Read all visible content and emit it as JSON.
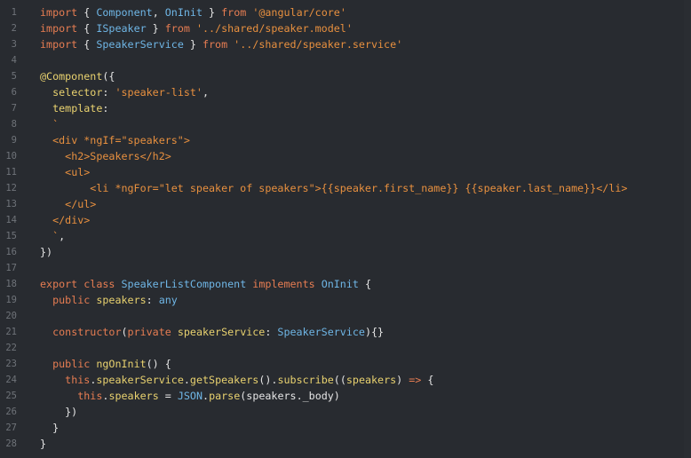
{
  "editor": {
    "lines": [
      {
        "n": "1",
        "tokens": [
          [
            "kw",
            "import "
          ],
          [
            "plain",
            "{ "
          ],
          [
            "ty",
            "Component"
          ],
          [
            "plain",
            ", "
          ],
          [
            "ty",
            "OnInit"
          ],
          [
            "plain",
            " } "
          ],
          [
            "kw",
            "from "
          ],
          [
            "str",
            "'@angular/core'"
          ]
        ]
      },
      {
        "n": "2",
        "tokens": [
          [
            "kw",
            "import "
          ],
          [
            "plain",
            "{ "
          ],
          [
            "ty",
            "ISpeaker"
          ],
          [
            "plain",
            " } "
          ],
          [
            "kw",
            "from "
          ],
          [
            "str",
            "'../shared/speaker.model'"
          ]
        ]
      },
      {
        "n": "3",
        "tokens": [
          [
            "kw",
            "import "
          ],
          [
            "plain",
            "{ "
          ],
          [
            "ty",
            "SpeakerService"
          ],
          [
            "plain",
            " } "
          ],
          [
            "kw",
            "from "
          ],
          [
            "str",
            "'../shared/speaker.service'"
          ]
        ]
      },
      {
        "n": "4",
        "tokens": []
      },
      {
        "n": "5",
        "tokens": [
          [
            "fn",
            "@Component"
          ],
          [
            "plain",
            "({"
          ]
        ]
      },
      {
        "n": "6",
        "tokens": [
          [
            "plain",
            "  "
          ],
          [
            "fn",
            "selector"
          ],
          [
            "plain",
            ": "
          ],
          [
            "str",
            "'speaker-list'"
          ],
          [
            "plain",
            ","
          ]
        ]
      },
      {
        "n": "7",
        "tokens": [
          [
            "plain",
            "  "
          ],
          [
            "fn",
            "template"
          ],
          [
            "plain",
            ":"
          ]
        ]
      },
      {
        "n": "8",
        "tokens": [
          [
            "plain",
            "  "
          ],
          [
            "tpl",
            "`"
          ]
        ]
      },
      {
        "n": "9",
        "tokens": [
          [
            "plain",
            "  "
          ],
          [
            "tpl",
            "<div *ngIf=\"speakers\">"
          ]
        ]
      },
      {
        "n": "10",
        "tokens": [
          [
            "plain",
            "    "
          ],
          [
            "tpl",
            "<h2>Speakers</h2>"
          ]
        ]
      },
      {
        "n": "11",
        "tokens": [
          [
            "plain",
            "    "
          ],
          [
            "tpl",
            "<ul>"
          ]
        ]
      },
      {
        "n": "12",
        "tokens": [
          [
            "plain",
            "        "
          ],
          [
            "tpl",
            "<li *ngFor=\"let speaker of speakers\">{{speaker.first_name}} {{speaker.last_name}}</li>"
          ]
        ]
      },
      {
        "n": "13",
        "tokens": [
          [
            "plain",
            "    "
          ],
          [
            "tpl",
            "</ul>"
          ]
        ]
      },
      {
        "n": "14",
        "tokens": [
          [
            "plain",
            "  "
          ],
          [
            "tpl",
            "</div>"
          ]
        ]
      },
      {
        "n": "15",
        "tokens": [
          [
            "plain",
            "  "
          ],
          [
            "tpl",
            "`"
          ],
          [
            "plain",
            ","
          ]
        ]
      },
      {
        "n": "16",
        "tokens": [
          [
            "plain",
            "})"
          ]
        ]
      },
      {
        "n": "17",
        "tokens": []
      },
      {
        "n": "18",
        "tokens": [
          [
            "kw",
            "export "
          ],
          [
            "kw",
            "class "
          ],
          [
            "ty",
            "SpeakerListComponent "
          ],
          [
            "kw",
            "implements "
          ],
          [
            "ty",
            "OnInit"
          ],
          [
            "plain",
            " {"
          ]
        ]
      },
      {
        "n": "19",
        "tokens": [
          [
            "plain",
            "  "
          ],
          [
            "kw",
            "public "
          ],
          [
            "fn",
            "speakers"
          ],
          [
            "plain",
            ": "
          ],
          [
            "ty",
            "any"
          ]
        ]
      },
      {
        "n": "20",
        "tokens": []
      },
      {
        "n": "21",
        "tokens": [
          [
            "plain",
            "  "
          ],
          [
            "kw",
            "constructor"
          ],
          [
            "plain",
            "("
          ],
          [
            "kw",
            "private "
          ],
          [
            "fn",
            "speakerService"
          ],
          [
            "plain",
            ": "
          ],
          [
            "ty",
            "SpeakerService"
          ],
          [
            "plain",
            "){}"
          ]
        ]
      },
      {
        "n": "22",
        "tokens": []
      },
      {
        "n": "23",
        "tokens": [
          [
            "plain",
            "  "
          ],
          [
            "kw",
            "public "
          ],
          [
            "fn",
            "ngOnInit"
          ],
          [
            "plain",
            "() {"
          ]
        ]
      },
      {
        "n": "24",
        "tokens": [
          [
            "plain",
            "    "
          ],
          [
            "kw",
            "this"
          ],
          [
            "plain",
            "."
          ],
          [
            "fn",
            "speakerService"
          ],
          [
            "plain",
            "."
          ],
          [
            "fn",
            "getSpeakers"
          ],
          [
            "plain",
            "()."
          ],
          [
            "fn",
            "subscribe"
          ],
          [
            "plain",
            "(("
          ],
          [
            "fn",
            "speakers"
          ],
          [
            "plain",
            ") "
          ],
          [
            "kw",
            "=>"
          ],
          [
            "plain",
            " {"
          ]
        ]
      },
      {
        "n": "25",
        "tokens": [
          [
            "plain",
            "      "
          ],
          [
            "kw",
            "this"
          ],
          [
            "plain",
            "."
          ],
          [
            "fn",
            "speakers"
          ],
          [
            "plain",
            " = "
          ],
          [
            "ty",
            "JSON"
          ],
          [
            "plain",
            "."
          ],
          [
            "fn",
            "parse"
          ],
          [
            "plain",
            "(speakers._body)"
          ]
        ]
      },
      {
        "n": "26",
        "tokens": [
          [
            "plain",
            "    })"
          ]
        ]
      },
      {
        "n": "27",
        "tokens": [
          [
            "plain",
            "  }"
          ]
        ]
      },
      {
        "n": "28",
        "tokens": [
          [
            "plain",
            "}"
          ]
        ]
      }
    ]
  }
}
